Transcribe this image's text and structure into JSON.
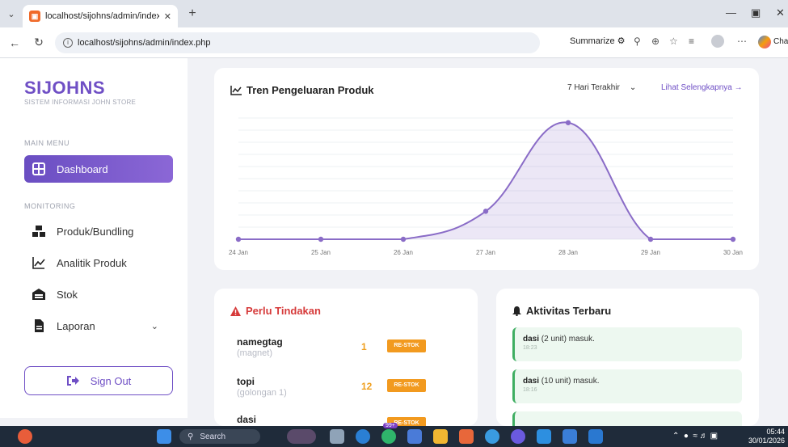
{
  "browser": {
    "tab_title": "localhost/sijohns/admin/index.php",
    "url": "localhost/sijohns/admin/index.php",
    "summarize_label": "Summarize",
    "copilot_label": "Chat"
  },
  "sidebar": {
    "brand": "SIJOHNS",
    "brand_sub": "SISTEM INFORMASI JOHN STORE",
    "main_menu_label": "MAIN MENU",
    "monitoring_label": "MONITORING",
    "items": [
      {
        "label": "Dashboard",
        "icon": "grid-icon",
        "active": true
      },
      {
        "label": "Produk/Bundling",
        "icon": "boxes-icon"
      },
      {
        "label": "Analitik Produk",
        "icon": "line-chart-icon"
      },
      {
        "label": "Stok",
        "icon": "warehouse-icon"
      },
      {
        "label": "Laporan",
        "icon": "document-icon"
      }
    ],
    "signout_label": "Sign Out"
  },
  "chart_card": {
    "title": "Tren Pengeluaran Produk",
    "range_value": "7 Hari Terakhir",
    "more_link": "Lihat Selengkapnya →"
  },
  "chart_data": {
    "type": "area",
    "categories": [
      "24 Jan",
      "25 Jan",
      "26 Jan",
      "27 Jan",
      "28 Jan",
      "29 Jan",
      "30 Jan"
    ],
    "values": [
      0,
      0,
      0,
      12,
      50,
      0,
      0
    ],
    "ylim": [
      0,
      52
    ],
    "grid": true,
    "color": "#8a6cc7"
  },
  "actions": {
    "title": "Perlu Tindakan",
    "badge_label": "RE-STOK",
    "rows": [
      {
        "name": "namegtag",
        "sub": "(magnet)",
        "qty": "1"
      },
      {
        "name": "topi",
        "sub": "(golongan 1)",
        "qty": "12"
      },
      {
        "name": "dasi",
        "sub": "",
        "qty": ""
      }
    ]
  },
  "activity": {
    "title": "Aktivitas Terbaru",
    "items": [
      {
        "item": "dasi",
        "text": "(2 unit) masuk.",
        "time": "18:23"
      },
      {
        "item": "dasi",
        "text": "(10 unit) masuk.",
        "time": "18:16"
      }
    ]
  },
  "taskbar": {
    "search_label": "Search",
    "time": "05:44",
    "date": "30/01/2026",
    "badge": "99+"
  }
}
